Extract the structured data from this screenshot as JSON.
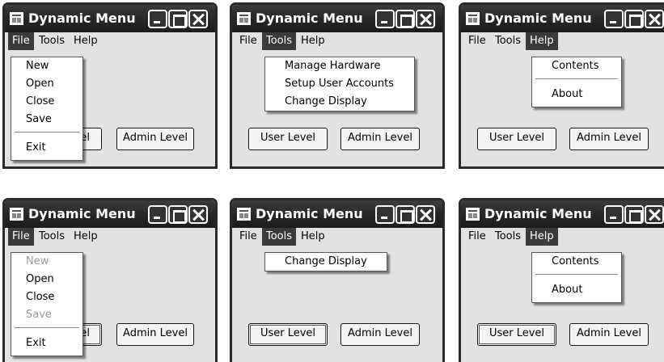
{
  "window_title": "Dynamic Menu",
  "menubar": {
    "file": "File",
    "tools": "Tools",
    "help": "Help"
  },
  "buttons": {
    "user_level": "User Level",
    "admin_level": "Admin Level",
    "user_level_partial": "el"
  },
  "file_menu": {
    "new": "New",
    "open": "Open",
    "close": "Close",
    "save": "Save",
    "exit": "Exit"
  },
  "tools_menu_admin": {
    "manage_hardware": "Manage Hardware",
    "setup_user_accounts": "Setup User Accounts",
    "change_display": "Change Display"
  },
  "tools_menu_user": {
    "change_display": "Change Display"
  },
  "help_menu": {
    "contents": "Contents",
    "about": "About"
  },
  "disabled_items": [
    "New",
    "Save"
  ],
  "colors": {
    "titlebar": "#262626",
    "menu_highlight": "#3a3a3a",
    "window_bg": "#e2e2e2",
    "menu_bg": "#ffffff",
    "disabled_text": "#9a9a9a"
  }
}
